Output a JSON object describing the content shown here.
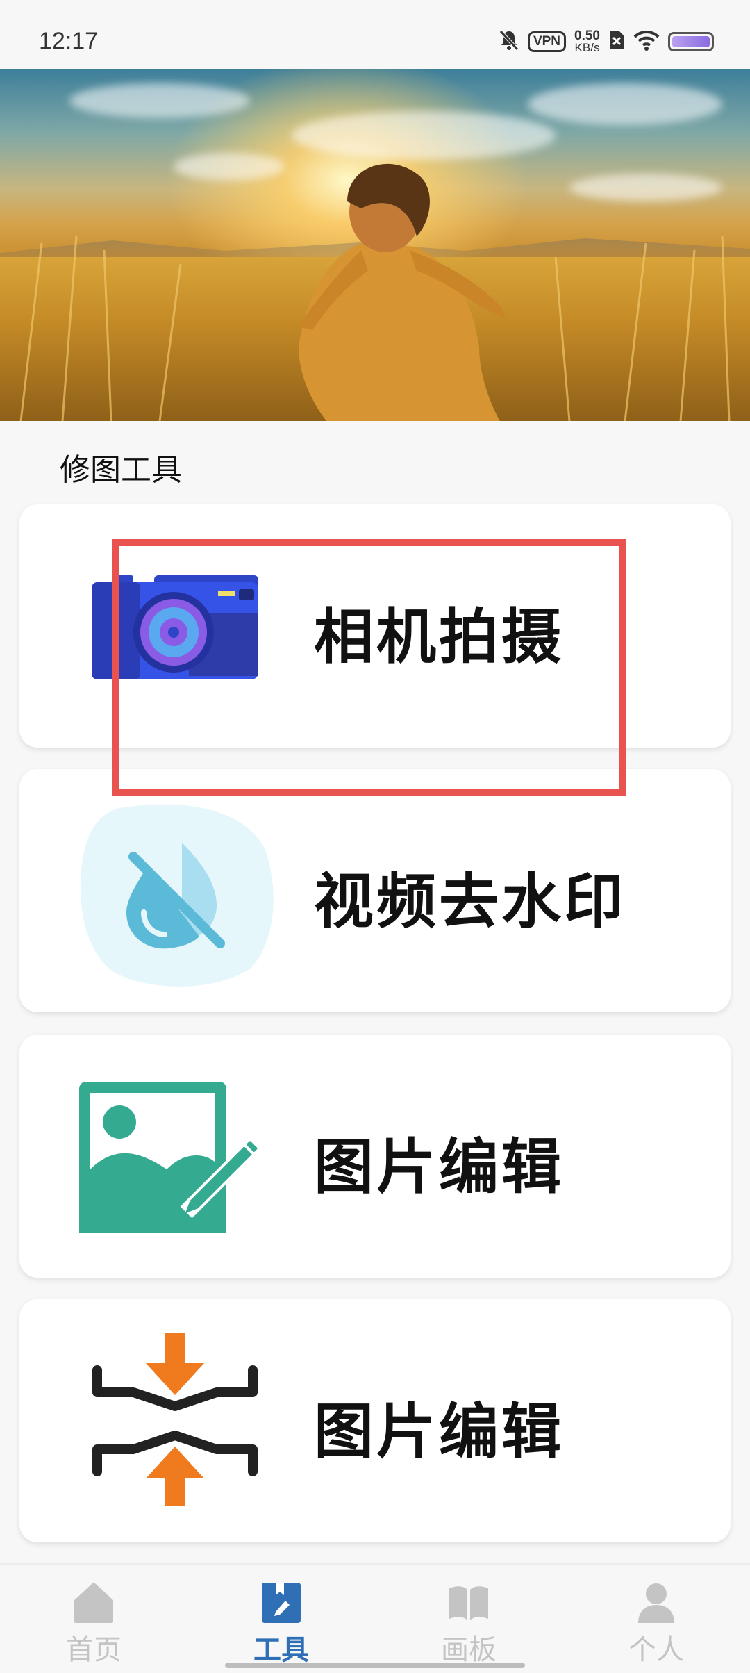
{
  "status_bar": {
    "time": "12:17",
    "vpn": "VPN",
    "net_speed_value": "0.50",
    "net_speed_unit": "KB/s",
    "icons": [
      "bell-off-icon",
      "vpn-icon",
      "network-speed",
      "no-sim-icon",
      "wifi-icon",
      "battery-icon"
    ]
  },
  "banner": {
    "image": "girl-running-in-wheat-field-at-sunset"
  },
  "section": {
    "title": "修图工具"
  },
  "tools": [
    {
      "label": "相机拍摄",
      "icon": "camera-icon"
    },
    {
      "label": "视频去水印",
      "icon": "watermark-remove-icon"
    },
    {
      "label": "图片编辑",
      "icon": "image-edit-icon"
    },
    {
      "label": "图片编辑",
      "icon": "image-compress-icon"
    }
  ],
  "highlight": {
    "color": "#e8524f"
  },
  "nav": {
    "items": [
      {
        "label": "首页",
        "icon": "home-icon",
        "active": false
      },
      {
        "label": "工具",
        "icon": "tools-icon",
        "active": true
      },
      {
        "label": "画板",
        "icon": "book-icon",
        "active": false
      },
      {
        "label": "个人",
        "icon": "person-icon",
        "active": false
      }
    ],
    "active_color": "#2f6fb6",
    "inactive_color": "#c4c4c4"
  }
}
